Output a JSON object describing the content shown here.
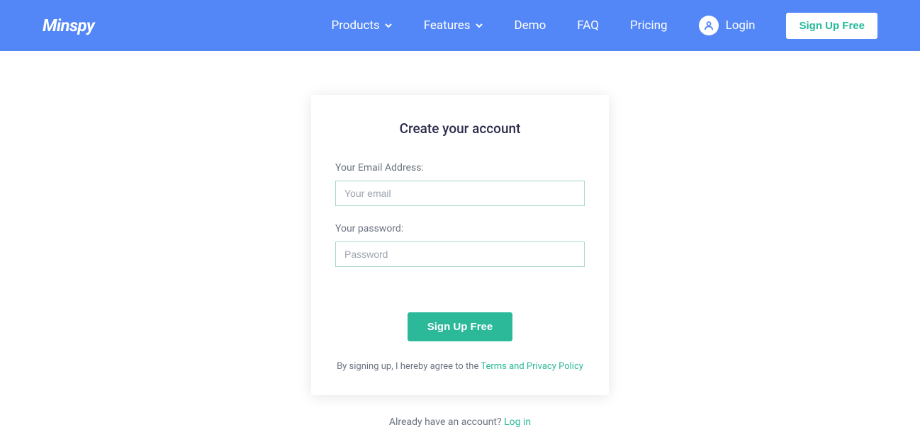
{
  "header": {
    "logo": "Minspy",
    "nav": {
      "products": "Products",
      "features": "Features",
      "demo": "Demo",
      "faq": "FAQ",
      "pricing": "Pricing",
      "login": "Login",
      "signup": "Sign Up Free"
    }
  },
  "form": {
    "title": "Create your account",
    "email_label": "Your Email Address:",
    "email_placeholder": "Your email",
    "password_label": "Your password:",
    "password_placeholder": "Password",
    "submit": "Sign Up Free",
    "agree_prefix": "By signing up, I hereby agree to the ",
    "agree_link": "Terms and Privacy Policy"
  },
  "footer": {
    "already_prefix": "Already have an account? ",
    "login_link": "Log in"
  }
}
